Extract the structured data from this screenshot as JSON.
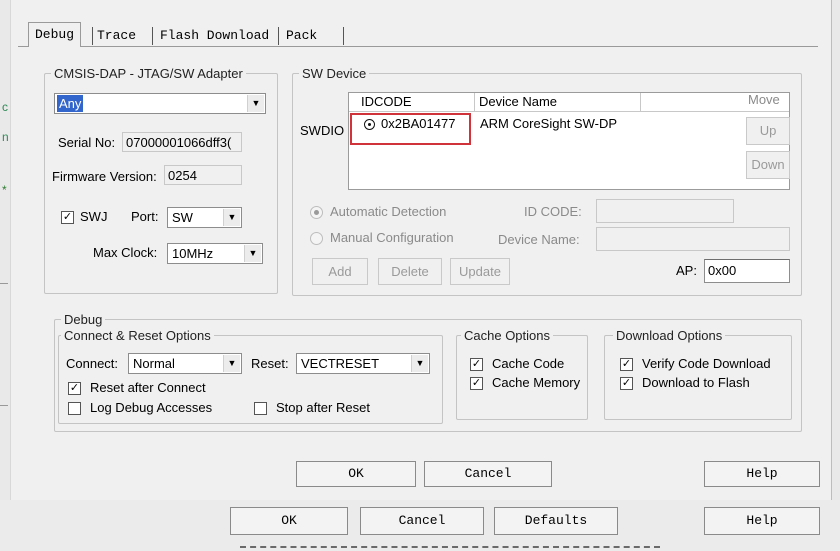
{
  "tabs": [
    "Debug",
    "Trace",
    "Flash Download",
    "Pack"
  ],
  "adapter": {
    "legend": "CMSIS-DAP - JTAG/SW Adapter",
    "adapter_value": "Any",
    "serial_label": "Serial No:",
    "serial_value": "07000001066dff3(",
    "firmware_label": "Firmware Version:",
    "firmware_value": "0254",
    "swj_label": "SWJ",
    "swj_checked": true,
    "port_label": "Port:",
    "port_value": "SW",
    "maxclock_label": "Max Clock:",
    "maxclock_value": "10MHz"
  },
  "sw_device": {
    "legend": "SW Device",
    "swdio_label": "SWDIO",
    "columns": [
      "IDCODE",
      "Device Name"
    ],
    "rows": [
      {
        "idcode": "0x2BA01477",
        "device_name": "ARM CoreSight SW-DP"
      }
    ],
    "move_label": "Move",
    "up_label": "Up",
    "down_label": "Down",
    "auto_detect_label": "Automatic Detection",
    "manual_config_label": "Manual Configuration",
    "id_code_label": "ID CODE:",
    "device_name_label": "Device Name:",
    "add_label": "Add",
    "delete_label": "Delete",
    "update_label": "Update",
    "ap_label": "AP:",
    "ap_value": "0x00"
  },
  "debug": {
    "legend": "Debug",
    "connect_reset": {
      "legend": "Connect & Reset Options",
      "connect_label": "Connect:",
      "connect_value": "Normal",
      "reset_label": "Reset:",
      "reset_value": "VECTRESET",
      "reset_after_connect_label": "Reset after Connect",
      "reset_after_connect_checked": true,
      "log_debug_label": "Log Debug Accesses",
      "log_debug_checked": false,
      "stop_after_reset_label": "Stop after Reset",
      "stop_after_reset_checked": false
    },
    "cache": {
      "legend": "Cache Options",
      "cache_code_label": "Cache Code",
      "cache_code_checked": true,
      "cache_memory_label": "Cache Memory",
      "cache_memory_checked": true
    },
    "download": {
      "legend": "Download Options",
      "verify_label": "Verify Code Download",
      "verify_checked": true,
      "download_flash_label": "Download to Flash",
      "download_flash_checked": true
    }
  },
  "dialog_buttons": {
    "ok": "OK",
    "cancel": "Cancel",
    "help": "Help"
  },
  "outer_buttons": {
    "ok": "OK",
    "cancel": "Cancel",
    "defaults": "Defaults",
    "help": "Help"
  },
  "check_glyph": "✓",
  "colors": {
    "highlight_box": "#d0343a",
    "selection": "#3366cc"
  }
}
